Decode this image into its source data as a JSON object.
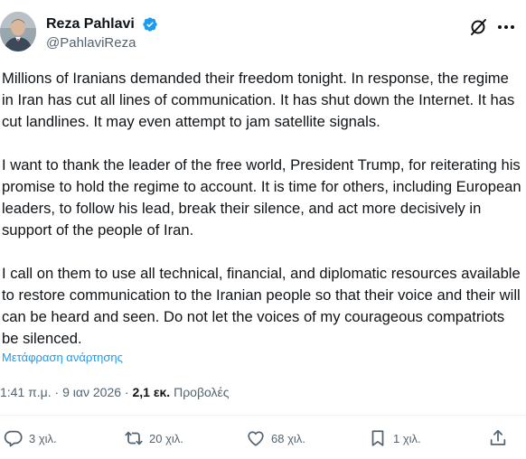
{
  "author": {
    "display_name": "Reza Pahlavi",
    "handle": "@PahlaviReza",
    "verified": true
  },
  "tweet": {
    "paragraphs": [
      "Millions of Iranians demanded their freedom tonight. In response, the regime in Iran has cut all lines of communication. It has shut down the Internet. It has cut landlines. It may even attempt to jam satellite signals.",
      "I want to thank the leader of the free world, President Trump, for reiterating his promise to hold the regime to account. It is time for others, including European leaders, to follow his lead, break their silence, and act more decisively in support of the people of Iran.",
      "I call on them to use all technical, financial, and diplomatic resources available to restore communication to the Iranian people so that their voice and their will can be heard and seen. Do not let the voices of my courageous compatriots be silenced."
    ],
    "translate_link": "Μετάφραση ανάρτησης",
    "time": "1:41 π.μ.",
    "separator": "·",
    "date": "9 ιαν 2026",
    "views_count": "2,1 εκ.",
    "views_label": "Προβολές"
  },
  "actions": {
    "reply_count": "3 χιλ.",
    "retweet_count": "20 χιλ.",
    "like_count": "68 χιλ.",
    "bookmark_count": "1 χιλ."
  },
  "icons": {
    "verified": "verified-badge-icon",
    "grok": "grok-icon",
    "more": "more-icon",
    "reply": "reply-icon",
    "retweet": "retweet-icon",
    "like": "heart-icon",
    "bookmark": "bookmark-icon",
    "share": "share-icon"
  },
  "colors": {
    "accent": "#1d9bf0",
    "text": "#0f1419",
    "secondary": "#536471"
  }
}
